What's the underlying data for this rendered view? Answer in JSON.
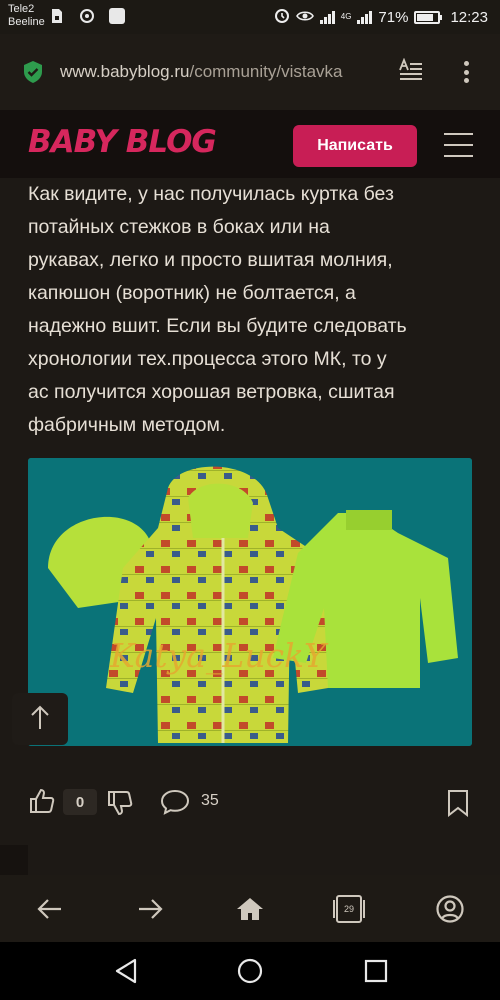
{
  "status_bar": {
    "carrier_1": "Tele2",
    "carrier_2": "Beeline",
    "network": "4G",
    "battery": "71%",
    "time": "12:23",
    "icons": [
      "sim-icon",
      "wifi-calling-icon",
      "square-notification-icon",
      "alarm-icon",
      "eye-icon",
      "signal-icon",
      "battery-icon"
    ]
  },
  "browser": {
    "url_host": "www.babyblog.ru",
    "url_path": "/community/vistavka",
    "secure_icon": "shield-check-icon",
    "secure_color": "#2e9b4d"
  },
  "site": {
    "logo": "BABY BLOG",
    "write_button": "Написать",
    "brand_color": "#c81e55"
  },
  "article": {
    "text": "Как видите, у нас получилась куртка без\nпотайных стежков в боках или на\nрукавах, легко и просто вшитая молния,\nкапюшон (воротник) не болтается, а\nнадежно вшит. Если вы будите следовать\nхронологии тех.процесса этого МК, то  у\nас получится хорошая ветровка, сшитая\nфабричным методом.",
    "photo_watermark": "Katya_LuckY"
  },
  "actions": {
    "likes": "0",
    "comments": "35"
  },
  "toolbar": {
    "tabs_count": "29"
  }
}
